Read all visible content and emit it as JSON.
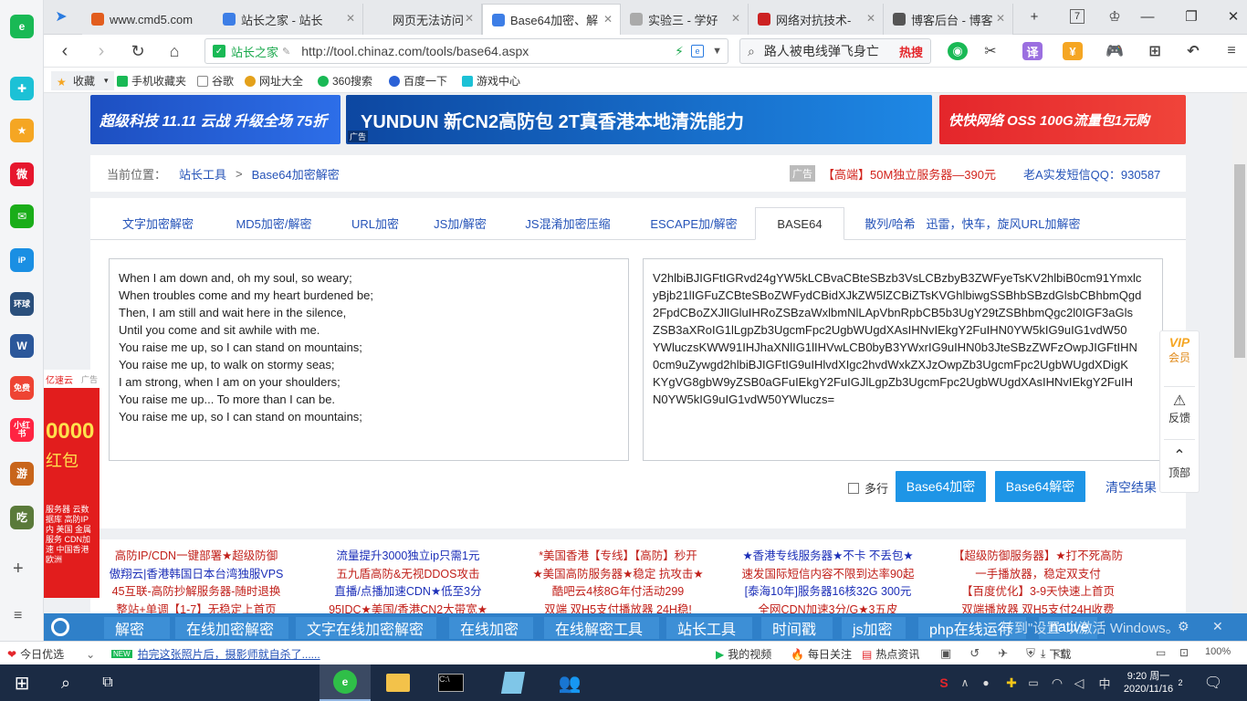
{
  "browser": {
    "tabs": [
      {
        "label": "www.cmd5.com",
        "color": "#e25d1e"
      },
      {
        "label": "站长之家 - 站长",
        "color": "#3d7ee6"
      },
      {
        "label": "网页无法访问",
        "color": ""
      },
      {
        "label": "Base64加密、解",
        "color": "#3d7ee6"
      },
      {
        "label": "实验三 - 学好",
        "color": "#aaaaaa"
      },
      {
        "label": "网络对抗技术-",
        "color": "#c22"
      },
      {
        "label": "博客后台 - 博客",
        "color": "#555555"
      }
    ],
    "tab_count": "7",
    "address": {
      "site_name": "站长之家",
      "url": "http://tool.chinaz.com/tools/base64.aspx"
    },
    "search": {
      "query": "路人被电线弹飞身亡",
      "hot_label": "热搜"
    },
    "toolbar": {
      "translate_label": "译"
    },
    "bookmarks": [
      "收藏",
      "手机收藏夹",
      "谷歌",
      "网址大全",
      "360搜索",
      "百度一下",
      "游戏中心"
    ]
  },
  "sidebar": {
    "items": [
      {
        "icon": "browser-logo-icon",
        "text": "e",
        "color": "#19b955"
      },
      {
        "icon": "plugin-icon",
        "text": "✚",
        "color": "#1cc1d6"
      },
      {
        "icon": "star-icon",
        "text": "★",
        "color": "#f5a623"
      },
      {
        "icon": "weibo-icon",
        "text": "微",
        "color": "#e6162d"
      },
      {
        "icon": "mail-icon",
        "text": "✉",
        "color": "#1aad19"
      },
      {
        "icon": "ip-icon",
        "text": "iP",
        "color": "#1a8fe3"
      },
      {
        "icon": "global-icon",
        "text": "环球",
        "color": "#2a4f7c"
      },
      {
        "icon": "document-icon",
        "text": "W",
        "color": "#2b579a"
      },
      {
        "icon": "novel-icon",
        "text": "免费",
        "color": "#e43"
      },
      {
        "icon": "redbook-icon",
        "text": "小红书",
        "color": "#ff2442"
      },
      {
        "icon": "game-icon",
        "text": "游",
        "color": "#c8651b"
      },
      {
        "icon": "game2-icon",
        "text": "吃",
        "color": "#5a7a3a"
      }
    ],
    "add_label": "+",
    "menu_label": "≡"
  },
  "banners": [
    {
      "text": "超级科技 11.11 云战 升级全场 75折",
      "color": "#1f56c9"
    },
    {
      "text": "YUNDUN 新CN2高防包 2T真香港本地清洗能力",
      "color": "#1565c0",
      "tag": "广告"
    },
    {
      "text": "快快网络 OSS 100G流量包1元购",
      "color": "#e4262b"
    }
  ],
  "breadcrumb": {
    "prefix": "当前位置：",
    "items": [
      "站长工具",
      ">",
      "Base64加密解密"
    ],
    "ad_tag": "广告",
    "ad_text": "【高端】50M独立服务器—390元",
    "qq": "老A实发短信QQ：930587"
  },
  "tool_tabs": [
    "文字加密解密",
    "MD5加密/解密",
    "URL加密",
    "JS加/解密",
    "JS混淆加密压缩",
    "ESCAPE加/解密",
    "BASE64",
    "散列/哈希",
    "迅雷，快车，旋风URL加解密"
  ],
  "active_tab_index": 6,
  "input_lines": [
    "When I am down and, oh my soul, so weary;",
    "When troubles come and my heart burdened be;",
    "Then, I am still and wait here in the silence,",
    "Until you come and sit awhile with me.",
    "You raise me up, so I can stand on mountains;",
    "You raise me up, to walk on stormy seas;",
    "I am strong, when I am on your shoulders;",
    "You raise me up... To more than I can be.",
    "You raise me up, so I can stand on mountains;"
  ],
  "output_lines": [
    "V2hlbiBJIGFtIGRvd24gYW5kLCBvaCBteSBzb3VsLCBzbyB3ZWFyeTsKV2hlbiB0cm91Ymxlc",
    "yBjb21lIGFuZCBteSBoZWFydCBidXJkZW5lZCBiZTsKVGhlbiwgSSBhbSBzdGlsbCBhbmQgd",
    "2FpdCBoZXJlIGluIHRoZSBzaWxlbmNlLApVbnRpbCB5b3UgY29tZSBhbmQgc2l0IGF3aGls",
    "ZSB3aXRoIG1lLgpZb3UgcmFpc2UgbWUgdXAsIHNvIEkgY2FuIHN0YW5kIG9uIG1vdW50",
    "YWluczsKWW91IHJhaXNlIG1lIHVwLCB0byB3YWxrIG9uIHN0b3JteSBzZWFzOwpJIGFtIHN",
    "0cm9uZywgd2hlbiBJIGFtIG9uIHlvdXIgc2hvdWxkZXJzOwpZb3UgcmFpc2UgbWUgdXDigK",
    "KYgVG8gbW9yZSB0aGFuIEkgY2FuIGJlLgpZb3UgcmFpc2UgbWUgdXAsIHNvIEkgY2FuIH",
    "N0YW5kIG9uIG1vdW50YWluczs="
  ],
  "controls": {
    "multiline_label": "多行",
    "encode_button": "Base64加密",
    "decode_button": "Base64解密",
    "clear_button": "清空结果"
  },
  "ad_columns": [
    [
      "高防IP/CDN一键部署★超级防御",
      "傲翔云|香港韩国日本台湾独服VPS",
      "45互联-高防抄解服务器-随时退换",
      "整站+单调【1-7】无稳定上首页"
    ],
    [
      "流量提升3000独立ip只需1元",
      "五九盾高防&无视DDOS攻击",
      "直播/点播加速CDN★低至3分",
      "95IDC★美国/香港CN2大带宽★"
    ],
    [
      "*美国香港【专线】【高防】秒开",
      "★美国高防服务器★稳定 抗攻击★",
      "酷吧云4核8G年付活动299",
      "双端 双H5支付播放器 24H稳!"
    ],
    [
      "★香港专线服务器★不卡 不丢包★",
      "速发国际短信内容不限到达率90起",
      "[泰海10年]服务器16核32G 300元",
      "全网CDN加速3分/G★3五皮"
    ],
    [
      "【超级防御服务器】★打不死高防",
      "一手播放器，稳定双支付",
      "【百度优化】3-9天快速上首页",
      "双端播放器 双H5支付24H收费"
    ]
  ],
  "left_ad": {
    "brand": "亿速云",
    "tag": "广告",
    "amount": "0000",
    "suffix": "红包",
    "text": "服务器 云数据库 高防IP 内 美国 金属服务 CDN加速 中国香港 欧洲"
  },
  "right_float": {
    "vip_label": "VIP",
    "member_label": "会员",
    "feedback_label": "反馈",
    "top_label": "顶部"
  },
  "keyword_bar": [
    "解密",
    "在线加密解密",
    "文字在线加密解密",
    "在线加密",
    "在线解密工具",
    "站长工具",
    "时间戳",
    "js加密",
    "php在线运行",
    "native"
  ],
  "watermark": {
    "line": "转到\"设置\"以激活 Windows。"
  },
  "status_bar": {
    "left": "今日优选",
    "new_badge": "NEW",
    "news": "拍完这张照片后，摄影师就自杀了......",
    "my_video": "我的视频",
    "daily_focus": "每日关注",
    "hot_news": "热点资讯",
    "download": "下载",
    "zoom": "100%"
  },
  "taskbar": {
    "time": "9:20 周一",
    "date": "2020/11/16",
    "notification_count": "2",
    "ime_label": "S"
  }
}
